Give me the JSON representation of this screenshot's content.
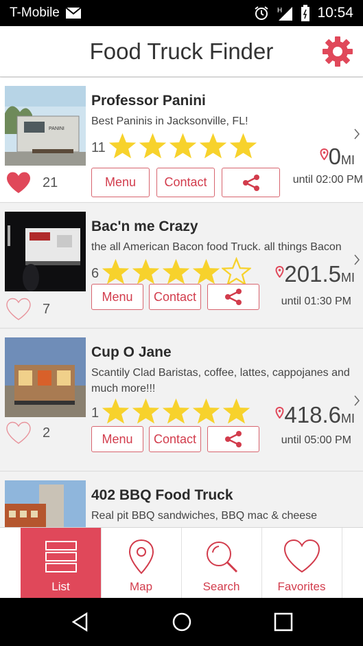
{
  "status_bar": {
    "carrier": "T-Mobile",
    "time": "10:54",
    "network": "H"
  },
  "app_bar": {
    "title": "Food Truck Finder"
  },
  "trucks": [
    {
      "name": "Professor Panini",
      "description": "Best Paninis in Jacksonville, FL!",
      "rating_count": "11",
      "stars": 5,
      "distance": "0",
      "distance_unit": "MI",
      "until": "until 02:00 PM",
      "favorites": "21",
      "is_favorite": true,
      "menu_label": "Menu",
      "contact_label": "Contact"
    },
    {
      "name": "Bac'n me Crazy",
      "description": "the all American Bacon food Truck. all things Bacon",
      "rating_count": "6",
      "stars": 4,
      "distance": "201.5",
      "distance_unit": "MI",
      "until": "until 01:30 PM",
      "favorites": "7",
      "is_favorite": false,
      "menu_label": "Menu",
      "contact_label": "Contact"
    },
    {
      "name": "Cup O Jane",
      "description": "Scantily Clad Baristas, coffee, lattes, cappojanes and much more!!!",
      "rating_count": "1",
      "stars": 5,
      "distance": "418.6",
      "distance_unit": "MI",
      "until": "until 05:00 PM",
      "favorites": "2",
      "is_favorite": false,
      "menu_label": "Menu",
      "contact_label": "Contact"
    },
    {
      "name": "402 BBQ Food Truck",
      "description": "Real pit BBQ sandwiches, BBQ mac & cheese"
    }
  ],
  "tabs": [
    {
      "label": "List",
      "icon": "list-icon",
      "active": true
    },
    {
      "label": "Map",
      "icon": "map-pin-icon",
      "active": false
    },
    {
      "label": "Search",
      "icon": "search-icon",
      "active": false
    },
    {
      "label": "Favorites",
      "icon": "heart-icon",
      "active": false
    }
  ],
  "colors": {
    "accent": "#e0485a",
    "star": "#f7d22c",
    "app_bar": "#ffffff"
  }
}
